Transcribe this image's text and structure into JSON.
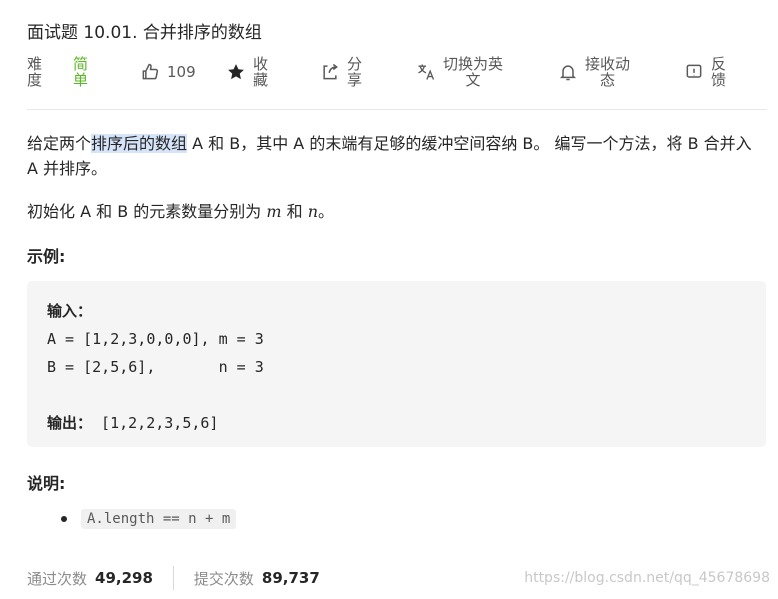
{
  "problem": {
    "title": "面试题 10.01. 合并排序的数组"
  },
  "meta": {
    "difficulty_label": "难度",
    "difficulty_value": "简单",
    "likes": "109",
    "favorite": "收藏",
    "share": "分享",
    "switch_lang": "切换为英文",
    "activity": "接收动态",
    "feedback": "反馈"
  },
  "description": {
    "p1_a": "给定两个",
    "p1_highlight": "排序后的数组",
    "p1_b": " A 和 B，其中 A 的末端有足够的缓冲空间容纳 B。 编写一个方法，将 B 合并入 A 并排序。",
    "p2_a": "初始化 A 和 B 的元素数量分别为 ",
    "p2_m": "m",
    "p2_mid": " 和 ",
    "p2_n": "n",
    "p2_end": "。"
  },
  "example": {
    "heading": "示例:",
    "input_label": "输入：",
    "line1": "A = [1,2,3,0,0,0], m = 3",
    "line2": "B = [2,5,6],       n = 3",
    "output_label": "输出：",
    "output_value": " [1,2,2,3,5,6]"
  },
  "notes": {
    "heading": "说明:",
    "item": "A.length == n + m"
  },
  "stats": {
    "passed_label": "通过次数",
    "passed_value": "49,298",
    "submitted_label": "提交次数",
    "submitted_value": "89,737"
  },
  "watermark": "https://blog.csdn.net/qq_45678698"
}
